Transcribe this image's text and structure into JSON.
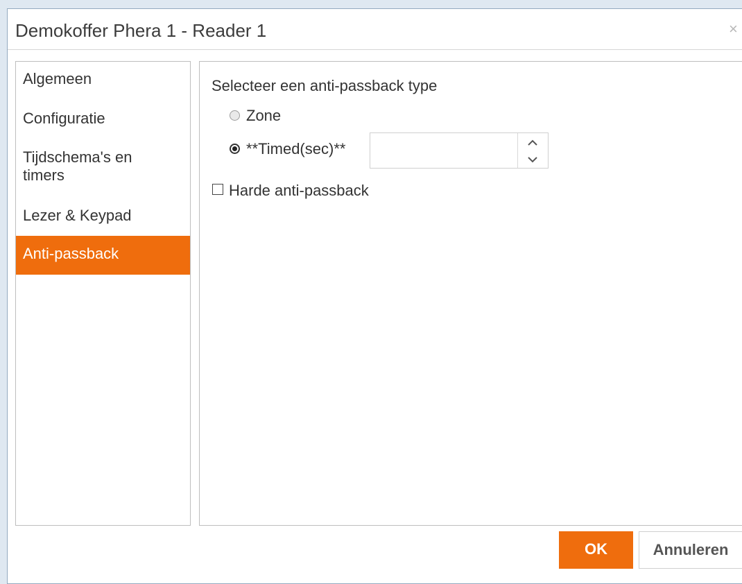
{
  "dialog": {
    "title": "Demokoffer Phera 1 - Reader 1",
    "close_symbol": "×"
  },
  "sidebar": {
    "items": [
      {
        "label": "Algemeen",
        "active": false
      },
      {
        "label": "Configuratie",
        "active": false
      },
      {
        "label": "Tijdschema's en timers",
        "active": false
      },
      {
        "label": "Lezer & Keypad",
        "active": false
      },
      {
        "label": "Anti-passback",
        "active": true
      }
    ]
  },
  "content": {
    "heading": "Selecteer een anti-passback type",
    "radio_zone": {
      "label": "Zone",
      "checked": false
    },
    "radio_timed": {
      "label": "**Timed(sec)**",
      "checked": true
    },
    "timed_value": "",
    "hard_antipassback": {
      "label": "Harde anti-passback",
      "checked": false
    }
  },
  "buttons": {
    "ok": "OK",
    "cancel": "Annuleren"
  },
  "colors": {
    "accent": "#ef6d0d",
    "background": "#dfe8f1"
  }
}
